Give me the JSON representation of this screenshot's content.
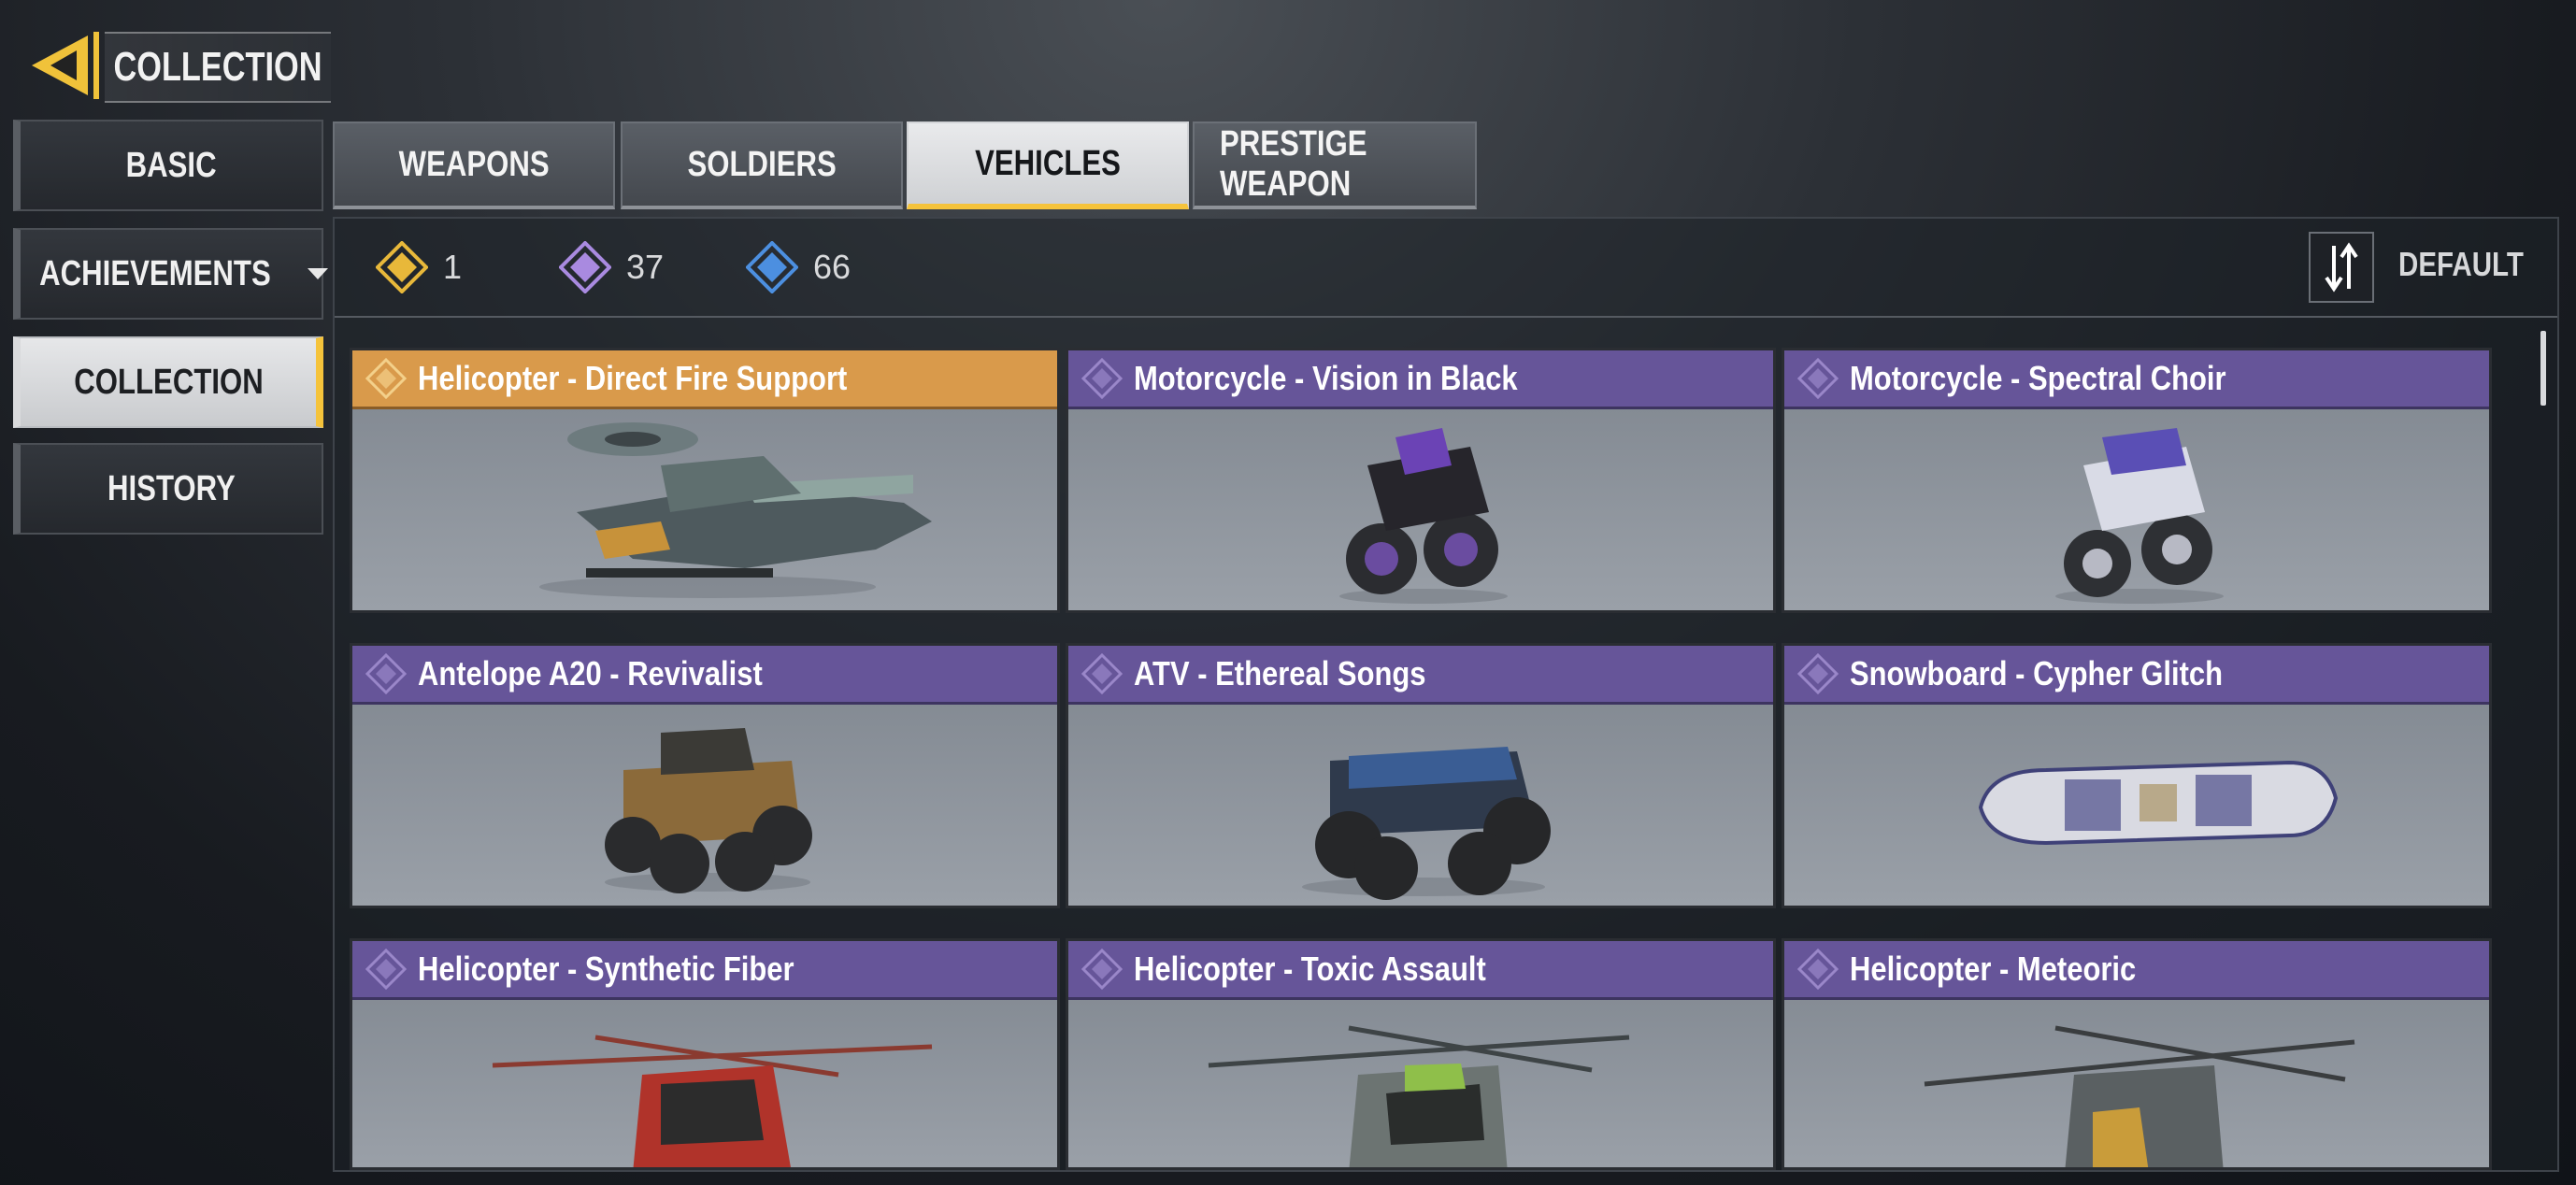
{
  "header": {
    "title": "COLLECTION"
  },
  "sidebar": {
    "items": [
      {
        "label": "BASIC",
        "active": false
      },
      {
        "label": "ACHIEVEMENTS",
        "active": false,
        "has_dropdown": true
      },
      {
        "label": "COLLECTION",
        "active": true
      },
      {
        "label": "HISTORY",
        "active": false
      }
    ]
  },
  "tabs": [
    {
      "label": "WEAPONS",
      "active": false
    },
    {
      "label": "SOLDIERS",
      "active": false
    },
    {
      "label": "VEHICLES",
      "active": true
    },
    {
      "label": "PRESTIGE WEAPON",
      "active": false
    }
  ],
  "stats": [
    {
      "rarity": "legendary",
      "color": "#e8b83a",
      "count": "1"
    },
    {
      "rarity": "epic",
      "color": "#a98ae0",
      "count": "37"
    },
    {
      "rarity": "rare",
      "color": "#4c8fe0",
      "count": "66"
    }
  ],
  "sort": {
    "label": "DEFAULT",
    "icon": "sort-icon"
  },
  "items": [
    {
      "name": "Helicopter - Direct Fire Support",
      "rarity": "legendary",
      "icon": "helicopter"
    },
    {
      "name": "Motorcycle - Vision in Black",
      "rarity": "epic",
      "icon": "motorcycle"
    },
    {
      "name": "Motorcycle - Spectral Choir",
      "rarity": "epic",
      "icon": "motorcycle"
    },
    {
      "name": "Antelope A20 - Revivalist",
      "rarity": "epic",
      "icon": "buggy"
    },
    {
      "name": "ATV -  Ethereal Songs",
      "rarity": "epic",
      "icon": "atv"
    },
    {
      "name": "Snowboard - Cypher Glitch",
      "rarity": "epic",
      "icon": "snowboard"
    },
    {
      "name": "Helicopter - Synthetic Fiber",
      "rarity": "epic",
      "icon": "helicopter"
    },
    {
      "name": "Helicopter - Toxic Assault",
      "rarity": "epic",
      "icon": "helicopter"
    },
    {
      "name": "Helicopter - Meteoric",
      "rarity": "epic",
      "icon": "helicopter"
    }
  ]
}
